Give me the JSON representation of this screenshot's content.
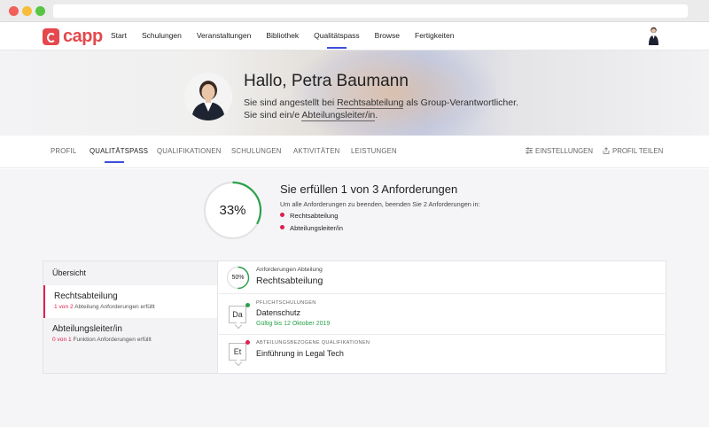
{
  "app": {
    "logo_text": "capp"
  },
  "nav": {
    "items": [
      {
        "label": "Start"
      },
      {
        "label": "Schulungen"
      },
      {
        "label": "Veranstaltungen"
      },
      {
        "label": "Bibliothek"
      },
      {
        "label": "Qualitätspass",
        "active": true
      },
      {
        "label": "Browse"
      },
      {
        "label": "Fertigkeiten"
      }
    ]
  },
  "hero": {
    "greeting": "Hallo, Petra Baumann",
    "line1_pre": "Sie sind angestellt bei ",
    "line1_link": "Rechtsabteilung",
    "line1_post": " als Group-Verantwortlicher.",
    "line2_pre": "Sie sind ein/e ",
    "line2_link": "Abteilungsleiter/in",
    "line2_post": "."
  },
  "tabs": {
    "items": [
      {
        "label": "PROFIL"
      },
      {
        "label": "QUALITÄTSPASS",
        "active": true
      },
      {
        "label": "QUALIFIKATIONEN"
      },
      {
        "label": "SCHULUNGEN"
      },
      {
        "label": "AKTIVITÄTEN"
      },
      {
        "label": "LEISTUNGEN"
      }
    ],
    "settings_label": "EINSTELLUNGEN",
    "share_label": "PROFIL TEILEN"
  },
  "summary": {
    "progress": 0.33,
    "progress_label": "33%",
    "title": "Sie erfüllen 1 von 3 Anforderungen",
    "subtitle": "Um alle Anforderungen zu beenden, beenden Sie 2 Anforderungen in:",
    "items": [
      "Rechtsabteilung",
      "Abteilungsleiter/in"
    ],
    "accent_color": "#2aa14a",
    "bullet_color": "#e0204f"
  },
  "overview": {
    "heading": "Übersicht",
    "items": [
      {
        "title": "Rechtsabteilung",
        "count": "1 von 2",
        "text": " Abteilung Anforderungen erfüllt",
        "active": true
      },
      {
        "title": "Abteilungsleiter/in",
        "count": "0 von 1",
        "text": " Funktion Anforderungen erfüllt"
      }
    ]
  },
  "detail": {
    "header_caption": "Anforderungen Abteilung",
    "header_title": "Rechtsabteilung",
    "progress": 0.5,
    "progress_label": "50%",
    "rows": [
      {
        "badge": "Da",
        "category": "PFLICHTSCHULUNGEN",
        "title": "Datenschutz",
        "valid": "Gültig bis 12 Oktober 2019",
        "status_color": "#2aa14a"
      },
      {
        "badge": "Et",
        "category": "ABTEILUNGSBEZOGENE QUALIFIKATIONEN",
        "title": "Einführung in Legal Tech",
        "status_color": "#e0204f"
      }
    ]
  }
}
